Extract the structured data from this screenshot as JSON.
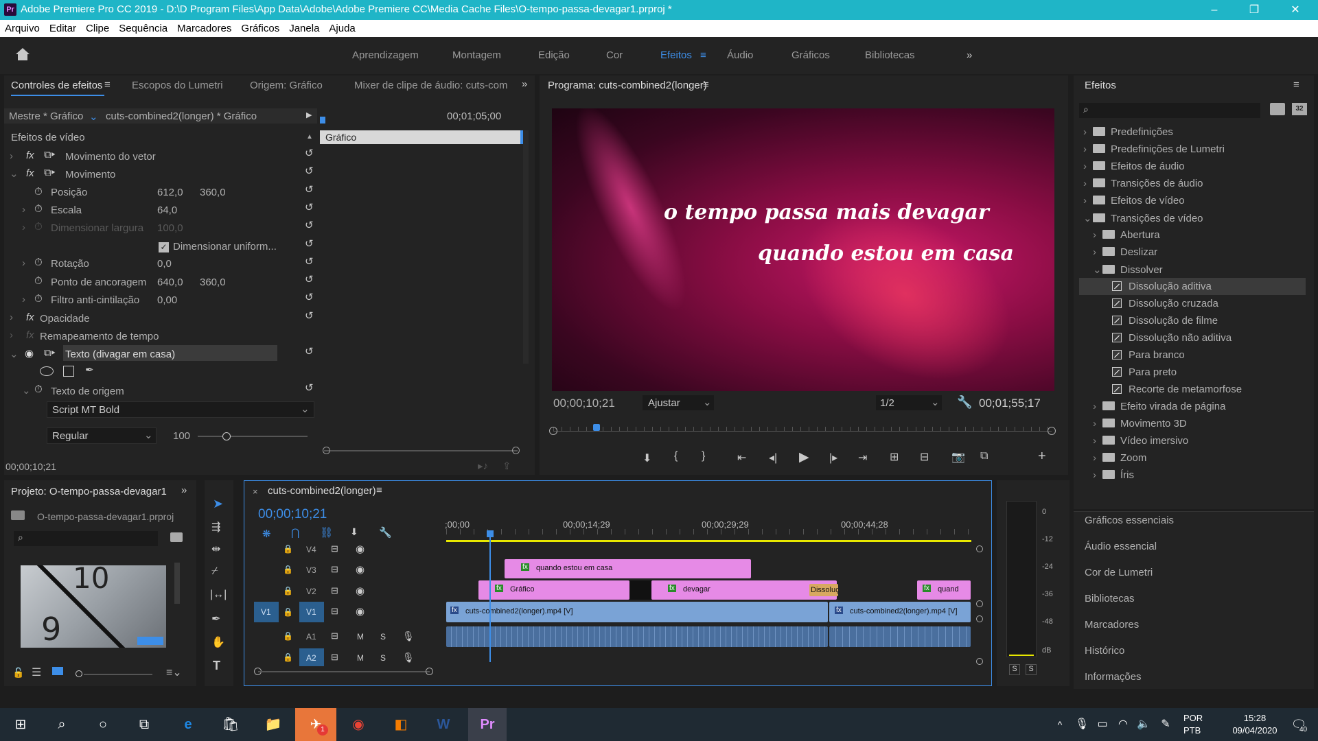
{
  "window": {
    "title": "Adobe Premiere Pro CC 2019 - D:\\D Program Files\\App Data\\Adobe\\Adobe Premiere CC\\Media Cache Files\\O-tempo-passa-devagar1.prproj *",
    "app_icon": "Pr",
    "controls": [
      "–",
      "❐",
      "✕"
    ]
  },
  "menu": [
    "Arquivo",
    "Editar",
    "Clipe",
    "Sequência",
    "Marcadores",
    "Gráficos",
    "Janela",
    "Ajuda"
  ],
  "workspaces": {
    "items": [
      "Aprendizagem",
      "Montagem",
      "Edição",
      "Cor",
      "Efeitos",
      "Áudio",
      "Gráficos",
      "Bibliotecas"
    ],
    "active": "Efeitos",
    "more": "»"
  },
  "effect_controls": {
    "tabs": [
      "Controles de efeitos",
      "Escopos do Lumetri",
      "Origem: Gráfico",
      "Mixer de clipe de áudio: cuts-com"
    ],
    "master": "Mestre * Gráfico",
    "clip": "cuts-combined2(longer) * Gráfico",
    "timecode_head": "00;01;05;00",
    "clip_bar": "Gráfico",
    "section": "Efeitos de vídeo",
    "rows": {
      "movimento_vetor": "Movimento do vetor",
      "movimento": "Movimento",
      "posicao": "Posição",
      "posicao_x": "612,0",
      "posicao_y": "360,0",
      "escala": "Escala",
      "escala_v": "64,0",
      "dim_largura": "Dimensionar largura",
      "dim_largura_v": "100,0",
      "dim_uniforme": "Dimensionar uniform...",
      "rotacao": "Rotação",
      "rotacao_v": "0,0",
      "ancoragem": "Ponto de ancoragem",
      "ancoragem_x": "640,0",
      "ancoragem_y": "360,0",
      "anticintilacao": "Filtro anti-cintilação",
      "anticintilacao_v": "0,00",
      "opacidade": "Opacidade",
      "remapeamento": "Remapeamento de tempo",
      "texto": "Texto (divagar em casa)",
      "texto_origem": "Texto de origem",
      "fonte": "Script MT Bold",
      "estilo": "Regular",
      "tamanho": "100"
    },
    "footer_timecode": "00;00;10;21"
  },
  "program": {
    "title": "Programa: cuts-combined2(longer)",
    "overlay_line1": "o tempo passa mais devagar",
    "overlay_line2": "quando estou em casa",
    "timecode": "00;00;10;21",
    "fit": "Ajustar",
    "resolution": "1/2",
    "duration": "00;01;55;17",
    "playhead_fraction": 0.08
  },
  "effects_panel": {
    "title": "Efeitos",
    "tree": [
      {
        "label": "Predefinições",
        "level": 0,
        "type": "folder-star"
      },
      {
        "label": "Predefinições de Lumetri",
        "level": 0,
        "type": "folder-star"
      },
      {
        "label": "Efeitos de áudio",
        "level": 0,
        "type": "folder"
      },
      {
        "label": "Transições de áudio",
        "level": 0,
        "type": "folder"
      },
      {
        "label": "Efeitos de vídeo",
        "level": 0,
        "type": "folder"
      },
      {
        "label": "Transições de vídeo",
        "level": 0,
        "type": "folder",
        "open": true
      },
      {
        "label": "Abertura",
        "level": 1,
        "type": "folder"
      },
      {
        "label": "Deslizar",
        "level": 1,
        "type": "folder"
      },
      {
        "label": "Dissolver",
        "level": 1,
        "type": "folder",
        "open": true
      },
      {
        "label": "Dissolução aditiva",
        "level": 2,
        "type": "fx",
        "selected": true
      },
      {
        "label": "Dissolução cruzada",
        "level": 2,
        "type": "fx"
      },
      {
        "label": "Dissolução de filme",
        "level": 2,
        "type": "fx"
      },
      {
        "label": "Dissolução não aditiva",
        "level": 2,
        "type": "fx"
      },
      {
        "label": "Para branco",
        "level": 2,
        "type": "fx"
      },
      {
        "label": "Para preto",
        "level": 2,
        "type": "fx"
      },
      {
        "label": "Recorte de metamorfose",
        "level": 2,
        "type": "fx"
      },
      {
        "label": "Efeito virada de página",
        "level": 1,
        "type": "folder"
      },
      {
        "label": "Movimento 3D",
        "level": 1,
        "type": "folder"
      },
      {
        "label": "Vídeo imersivo",
        "level": 1,
        "type": "folder"
      },
      {
        "label": "Zoom",
        "level": 1,
        "type": "folder"
      },
      {
        "label": "Íris",
        "level": 1,
        "type": "folder"
      }
    ],
    "other_panels": [
      "Gráficos essenciais",
      "Áudio essencial",
      "Cor de Lumetri",
      "Bibliotecas",
      "Marcadores",
      "Histórico",
      "Informações"
    ]
  },
  "project": {
    "title": "Projeto: O-tempo-passa-devagar1",
    "file": "O-tempo-passa-devagar1.prproj"
  },
  "timeline": {
    "tab": "cuts-combined2(longer)",
    "timecode": "00;00;10;21",
    "ruler": [
      ";00;00",
      "00;00;14;29",
      "00;00;29;29",
      "00;00;44;28"
    ],
    "tracks": [
      "V4",
      "V3",
      "V2",
      "V1",
      "A1",
      "A2"
    ],
    "source_v": "V1",
    "clips": {
      "v3": "quando estou em casa",
      "v2a": "Gráfico",
      "v2b": "devagar",
      "v2c": "Dissolução",
      "v2d": "quand",
      "v1a": "cuts-combined2(longer).mp4 [V]",
      "v1b": "cuts-combined2(longer).mp4 [V]"
    },
    "mute": "M",
    "solo": "S"
  },
  "meter": {
    "scale": [
      "0",
      "-12",
      "-24",
      "-36",
      "-48",
      "dB"
    ],
    "solo": [
      "S",
      "S"
    ]
  },
  "taskbar": {
    "lang": "POR",
    "layout": "PTB",
    "time": "15:28",
    "date": "09/04/2020",
    "notif": "40",
    "badge": "1"
  },
  "colors": {
    "accent": "#3d8ee8",
    "titlebar": "#1fb5c7",
    "clip_pink": "#e68ae6",
    "clip_blue": "#7aa3d6"
  }
}
